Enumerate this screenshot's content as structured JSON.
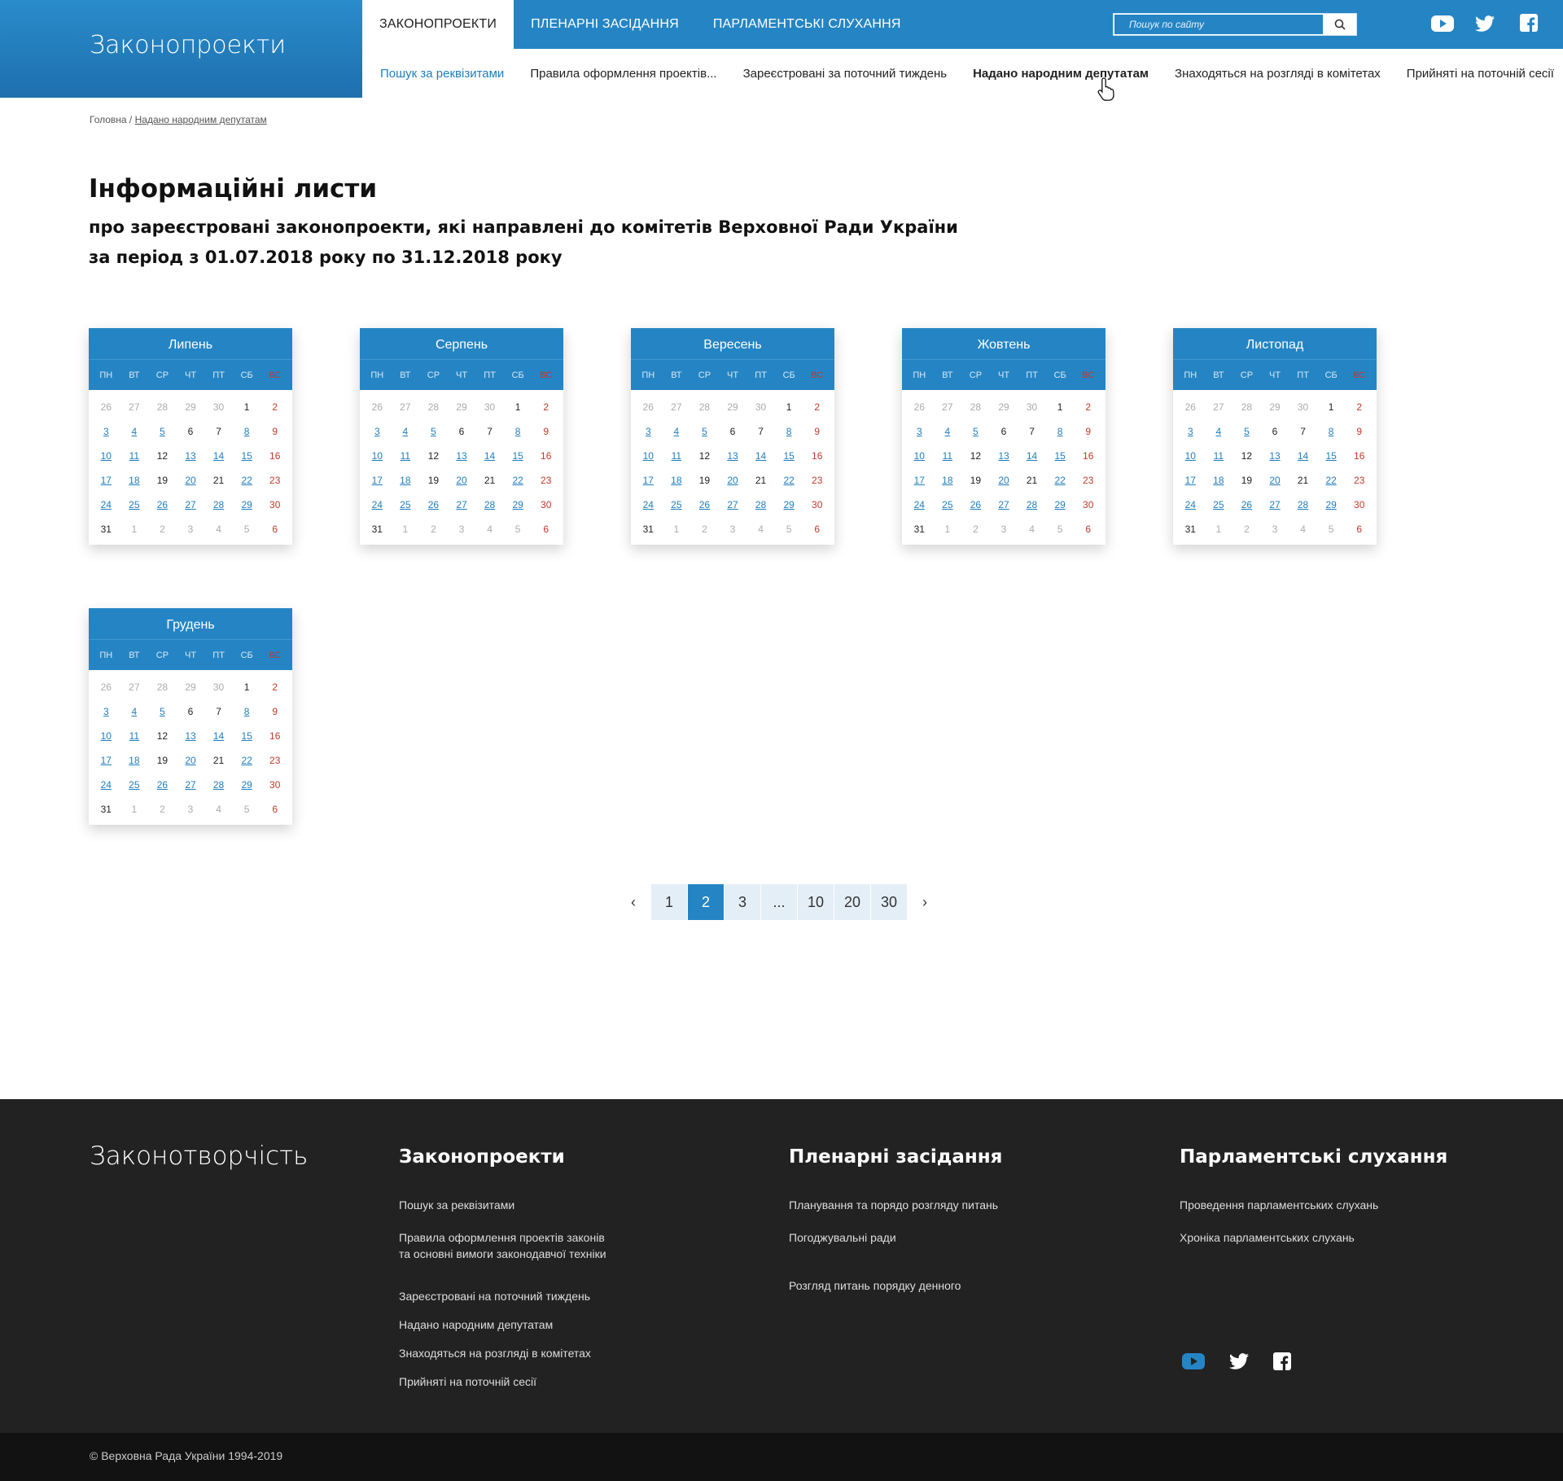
{
  "header": {
    "brand": "Законопроекти",
    "top_nav": [
      "Законопроекти",
      "Пленарні засідання",
      "Парламентські слухання"
    ],
    "active_top": 0,
    "search_placeholder": "Пошук по сайту",
    "sub_nav": [
      {
        "label": "Пошук за реквізитами",
        "style": "blue"
      },
      {
        "label": "Правила оформлення проектів...",
        "style": ""
      },
      {
        "label": "Зареєстровані за поточний тиждень",
        "style": ""
      },
      {
        "label": "Надано народним депутатам",
        "style": "bold"
      },
      {
        "label": "Знаходяться на розгляді в комітетах",
        "style": ""
      },
      {
        "label": "Прийняті на поточній сесії",
        "style": ""
      }
    ]
  },
  "breadcrumb": {
    "home": "Головна",
    "sep": " / ",
    "current": "Надано народним депутатам"
  },
  "page": {
    "title": "Інформаційні листи",
    "subtitle": "про зареєстровані законопроекти, які направлені до комітетів Верховної Ради України",
    "period": "за період з 01.07.2018 року по 31.12.2018 року"
  },
  "weekdays": [
    "ПН",
    "ВТ",
    "СР",
    "ЧТ",
    "ПТ",
    "СБ",
    "ВС"
  ],
  "months": [
    "Липень",
    "Серпень",
    "Вересень",
    "Жовтень",
    "Листопад",
    "Грудень"
  ],
  "calendar_days": [
    [
      "26",
      "27",
      "28",
      "29",
      "30",
      "1",
      "2"
    ],
    [
      "3",
      "4",
      "5",
      "6",
      "7",
      "8",
      "9"
    ],
    [
      "10",
      "11",
      "12",
      "13",
      "14",
      "15",
      "16"
    ],
    [
      "17",
      "18",
      "19",
      "20",
      "21",
      "22",
      "23"
    ],
    [
      "24",
      "25",
      "26",
      "27",
      "28",
      "29",
      "30"
    ],
    [
      "31",
      "1",
      "2",
      "3",
      "4",
      "5",
      "6"
    ]
  ],
  "linked_days": [
    "3",
    "4",
    "5",
    "8",
    "10",
    "11",
    "13",
    "14",
    "15",
    "17",
    "18",
    "20",
    "22",
    "24",
    "25",
    "26",
    "27",
    "28",
    "29"
  ],
  "pagination": {
    "prev": "‹",
    "pages": [
      "1",
      "2",
      "3",
      "...",
      "10",
      "20",
      "30"
    ],
    "current": "2",
    "next": "›"
  },
  "footer": {
    "brand": "Законотворчість",
    "columns": [
      {
        "title": "Законопроекти",
        "links": [
          "Пошук за реквізитами",
          "Правила оформлення проектів законів\nта основні вимоги законодавчої техніки",
          "Зареєстровані на поточний тиждень",
          "Надано народним депутатам",
          "Знаходяться на розгляді в комітетах",
          "Прийняті на поточній сесії"
        ]
      },
      {
        "title": "Пленарні засідання",
        "links": [
          "Планування та порядо розгляду питань",
          "Погоджувальні ради",
          "Розгляд питань порядку денного"
        ]
      },
      {
        "title": "Парламентські слухання",
        "links": [
          "Проведення парламентських слухань",
          "Хроніка парламентських слухань"
        ]
      }
    ],
    "copyright": "© Верховна Рада України 1994-2019"
  },
  "colors": {
    "primary": "#2585c4",
    "link": "#1f7dbd",
    "sunday": "#c0392b",
    "footer": "#222222"
  }
}
